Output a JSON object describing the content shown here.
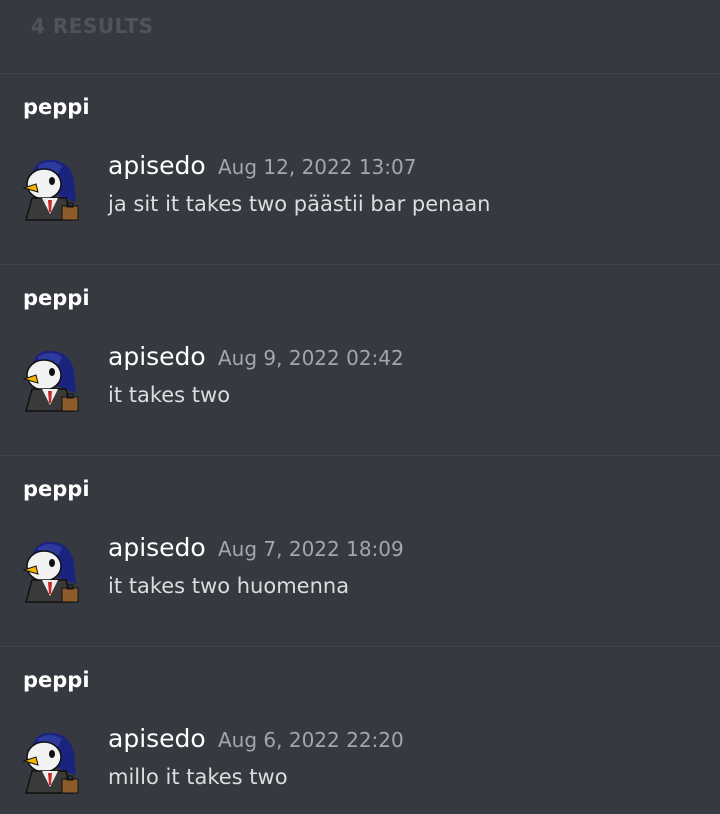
{
  "results_header": {
    "count_label": "4 RESULTS"
  },
  "results": [
    {
      "channel": "peppi",
      "author": "apisedo",
      "timestamp": "Aug 12, 2022 13:07",
      "text": "ja sit it takes two päästii bar penaan"
    },
    {
      "channel": "peppi",
      "author": "apisedo",
      "timestamp": "Aug 9, 2022 02:42",
      "text": "it takes two"
    },
    {
      "channel": "peppi",
      "author": "apisedo",
      "timestamp": "Aug 7, 2022 18:09",
      "text": "it takes two huomenna"
    },
    {
      "channel": "peppi",
      "author": "apisedo",
      "timestamp": "Aug 6, 2022 22:20",
      "text": "millo it takes two"
    }
  ],
  "colors": {
    "background": "#36393f",
    "divider": "#42454b",
    "muted_header": "#4f545c",
    "timestamp": "#a3a6aa"
  },
  "icons": {
    "avatar": "penguin-avatar-icon"
  }
}
